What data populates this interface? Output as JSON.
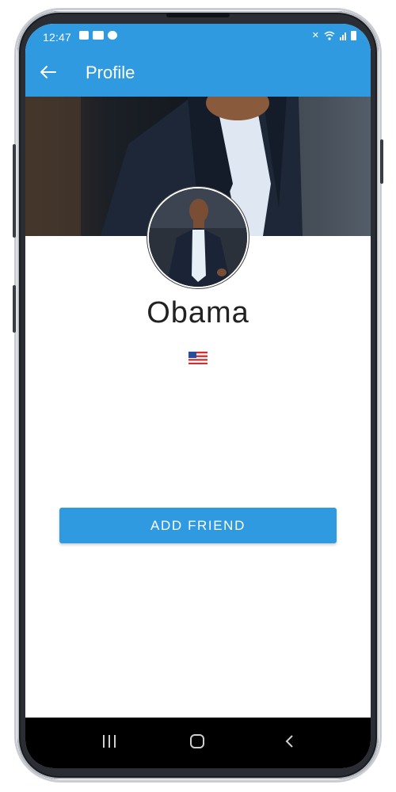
{
  "status_bar": {
    "time": "12:47",
    "left_icons": [
      "image-icon",
      "youtube-icon",
      "account-icon"
    ],
    "right_icons": [
      "mute-icon",
      "wifi-icon",
      "signal-icon",
      "battery-icon"
    ]
  },
  "app_bar": {
    "title": "Profile",
    "back_icon": "arrow-left-icon"
  },
  "profile": {
    "name": "Obama",
    "flag": "🇺🇸",
    "cover_image": "cover-photo",
    "avatar_image": "profile-avatar"
  },
  "actions": {
    "add_friend_label": "ADD FRIEND"
  },
  "nav_bar": {
    "recent_icon": "recent-apps-icon",
    "home_icon": "home-icon",
    "back_icon": "back-icon"
  },
  "colors": {
    "primary": "#2f9ae0",
    "text": "#222222",
    "background": "#ffffff",
    "nav_bar": "#000000"
  }
}
